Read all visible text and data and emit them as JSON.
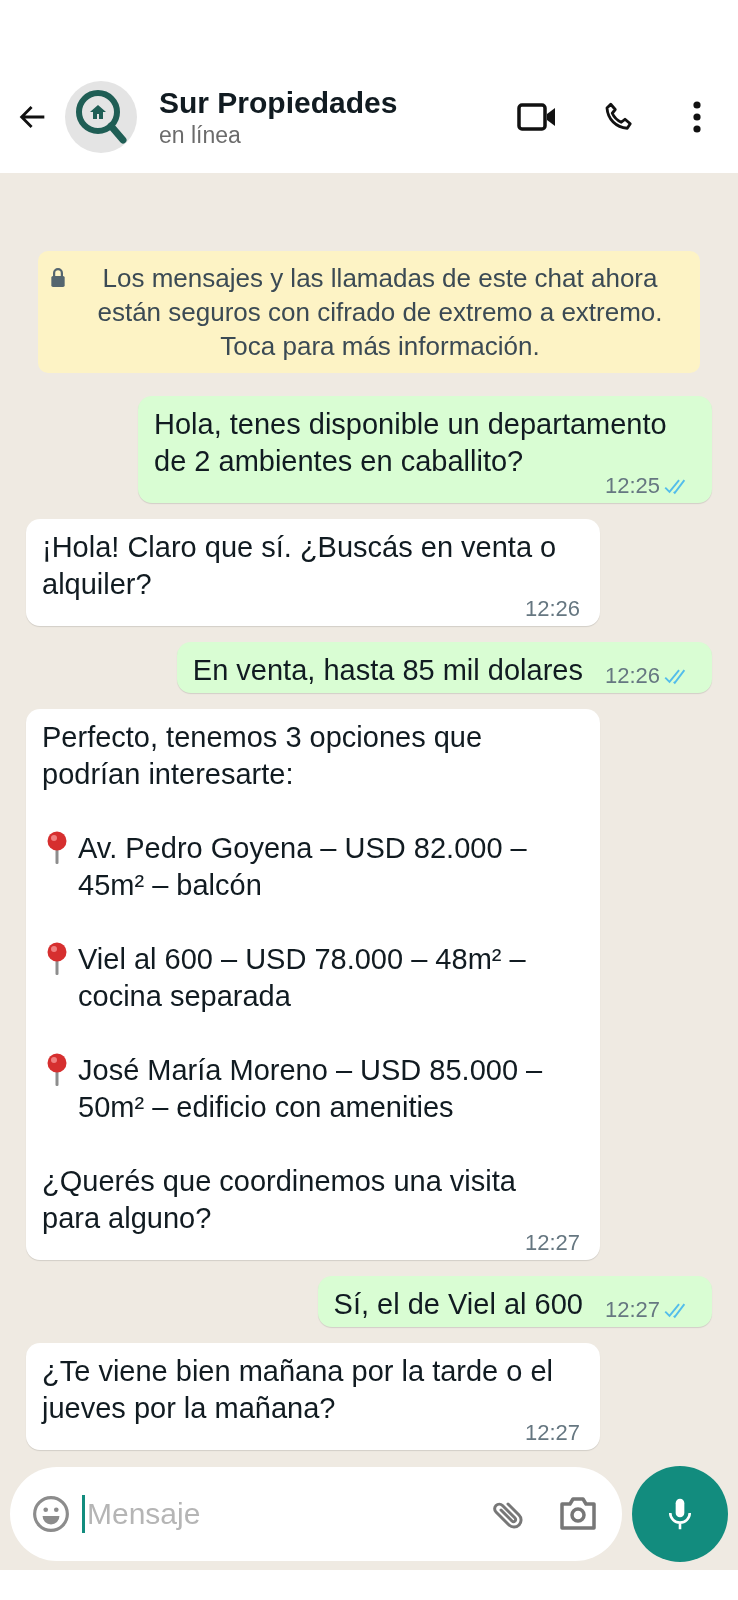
{
  "header": {
    "title": "Sur Propiedades",
    "status": "en línea"
  },
  "notice": {
    "text": "Los mensajes y las llamadas de este chat ahora están seguros con cifrado de extremo a extremo. Toca para más información."
  },
  "messages": [
    {
      "kind": "sent",
      "paragraphs": [
        {
          "kind": "text",
          "text": "Hola, tenes disponible un departamento de 2 ambientes en caballito?"
        }
      ],
      "time": "12:25",
      "read": true
    },
    {
      "kind": "received",
      "paragraphs": [
        {
          "kind": "text",
          "text": "¡Hola! Claro que sí. ¿Buscás en venta o alquiler?"
        }
      ],
      "time": "12:26"
    },
    {
      "kind": "sent",
      "paragraphs": [
        {
          "kind": "text",
          "text": "En venta, hasta 85 mil dolares"
        }
      ],
      "time": "12:26",
      "read": true
    },
    {
      "kind": "received",
      "paragraphs": [
        {
          "kind": "text",
          "text": "Perfecto, tenemos 3 opciones que podrían interesarte:"
        },
        {
          "kind": "pin",
          "text": "Av. Pedro Goyena – USD 82.000 – 45m² – balcón"
        },
        {
          "kind": "pin",
          "text": "Viel al 600 – USD 78.000 – 48m² – cocina separada"
        },
        {
          "kind": "pin",
          "text": "José María Moreno – USD 85.000 – 50m² – edificio con amenities"
        },
        {
          "kind": "text",
          "text": "¿Querés que coordinemos una visita para alguno?"
        }
      ],
      "time": "12:27"
    },
    {
      "kind": "sent",
      "paragraphs": [
        {
          "kind": "text",
          "text": "Sí, el de Viel al 600"
        }
      ],
      "time": "12:27",
      "read": true
    },
    {
      "kind": "received",
      "paragraphs": [
        {
          "kind": "text",
          "text": "¿Te viene bien mañana por la tarde o el jueves por la mañana?"
        }
      ],
      "time": "12:27"
    }
  ],
  "composer": {
    "placeholder": "Mensaje"
  }
}
